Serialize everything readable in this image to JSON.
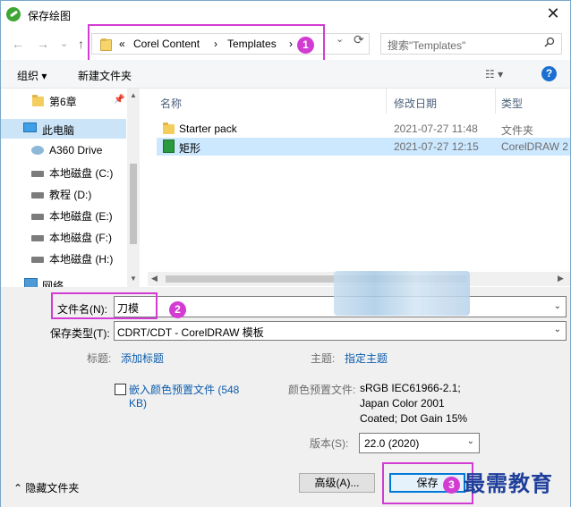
{
  "window": {
    "title": "保存绘图",
    "close": "✕"
  },
  "nav": {
    "back": "←",
    "forward": "→",
    "recent": "⌄",
    "up": "↑",
    "breadcrumb": [
      "«",
      "Corel Content",
      "›",
      "Templates",
      "›"
    ],
    "dropdown": "⌄",
    "refresh": "⟳",
    "search_placeholder": "搜索\"Templates\""
  },
  "toolbar": {
    "organize": "组织 ▾",
    "new_folder": "新建文件夹",
    "view": "☷ ▾",
    "help": "?"
  },
  "sidebar": {
    "items": [
      {
        "label": "第6章",
        "icon": "folder-icon",
        "pinned": true
      },
      {
        "label": "此电脑",
        "icon": "computer-icon"
      },
      {
        "label": "A360 Drive",
        "icon": "cloud-drive-icon"
      },
      {
        "label": "本地磁盘 (C:)",
        "icon": "drive-icon"
      },
      {
        "label": "教程 (D:)",
        "icon": "drive-icon"
      },
      {
        "label": "本地磁盘 (E:)",
        "icon": "drive-icon"
      },
      {
        "label": "本地磁盘 (F:)",
        "icon": "drive-icon"
      },
      {
        "label": "本地磁盘 (H:)",
        "icon": "drive-icon"
      },
      {
        "label": "网络",
        "icon": "network-icon"
      }
    ]
  },
  "files": {
    "columns": [
      "名称",
      "修改日期",
      "类型"
    ],
    "rows": [
      {
        "name": "Starter pack",
        "date": "2021-07-27 11:48",
        "type": "文件夹",
        "icon": "folder-icon"
      },
      {
        "name": "矩形",
        "date": "2021-07-27 12:15",
        "type": "CorelDRAW 2",
        "icon": "coreldraw-file-icon"
      }
    ]
  },
  "form": {
    "filename_label": "文件名(N):",
    "filename_value": "刀模",
    "filetype_label": "保存类型(T):",
    "filetype_value": "CDRT/CDT - CorelDRAW 模板",
    "title_label": "标题:",
    "title_link": "添加标题",
    "subject_label": "主题:",
    "subject_link": "指定主题",
    "embed_label_1": "嵌入颜色预置文件 (548",
    "embed_label_2": "KB)",
    "color_profile_label": "颜色预置文件:",
    "color_profile_lines": [
      "sRGB IEC61966-2.1;",
      "Japan Color 2001",
      "Coated; Dot Gain 15%"
    ],
    "version_label": "版本(S):",
    "version_value": "22.0 (2020)",
    "hide_folders": "隐藏文件夹",
    "advanced": "高级(A)...",
    "save": "保存"
  },
  "annotations": {
    "badge1": "1",
    "badge2": "2",
    "badge3": "3"
  },
  "watermark": "最需教育",
  "colors": {
    "callout": "#d33cd3",
    "accent": "#0078d7",
    "link": "#0b5cad"
  }
}
